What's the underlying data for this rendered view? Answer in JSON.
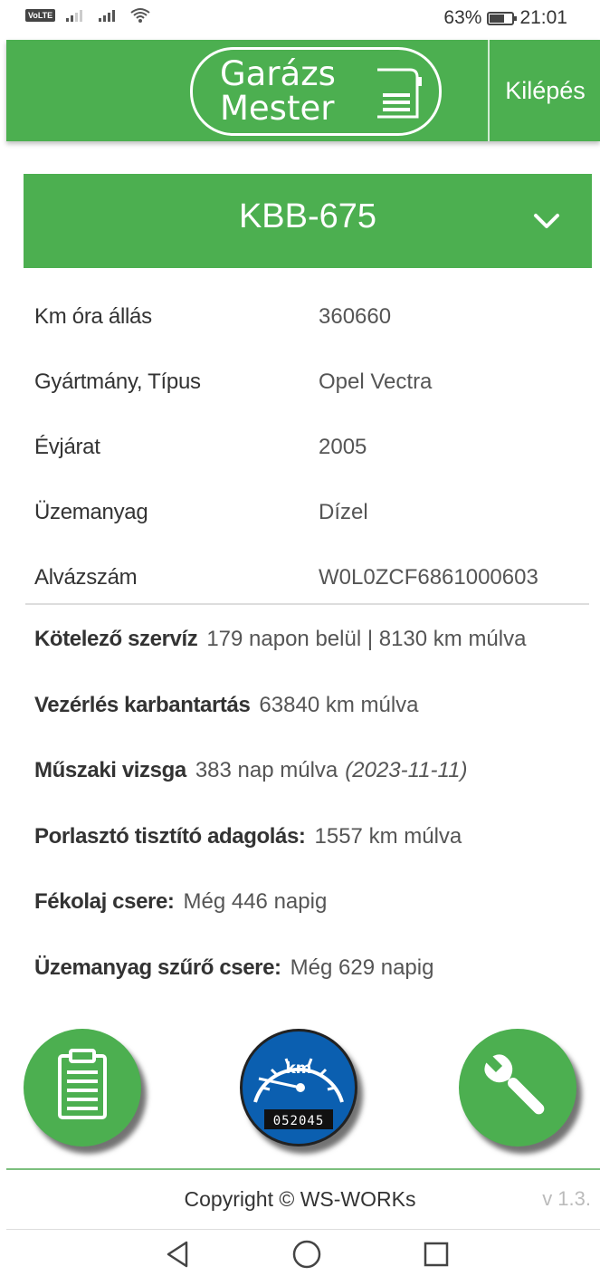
{
  "status_bar": {
    "network_badge": "VoLTE",
    "battery_percent": "63%",
    "battery_level": 0.63,
    "time": "21:01"
  },
  "header": {
    "logo_line1": "Garázs",
    "logo_line2": "Mester",
    "logout_label": "Kilépés",
    "accent_color": "#4caf50"
  },
  "vehicle": {
    "plate": "KBB-675",
    "details": [
      {
        "label": "Km óra állás",
        "value": "360660"
      },
      {
        "label": "Gyártmány, Típus",
        "value": "Opel Vectra"
      },
      {
        "label": "Évjárat",
        "value": "2005"
      },
      {
        "label": "Üzemanyag",
        "value": "Dízel"
      },
      {
        "label": "Alvázszám",
        "value": "W0L0ZCF6861000603"
      }
    ]
  },
  "services": [
    {
      "label": "Kötelező szervíz",
      "value": "179 napon belül | 8130 km múlva"
    },
    {
      "label": "Vezérlés karbantartás",
      "value": "63840 km múlva"
    },
    {
      "label": "Műszaki vizsga",
      "value": "383 nap múlva",
      "date": "(2023-11-11)"
    },
    {
      "label": "Porlasztó tisztító adagolás:",
      "value": "1557 km múlva"
    },
    {
      "label": "Fékolaj csere:",
      "value": "Még 446 napig"
    },
    {
      "label": "Üzemanyag szűrő csere:",
      "value": "Még 629 napig"
    }
  ],
  "actions": {
    "clipboard_icon": "clipboard-icon",
    "odometer_unit": "km",
    "odometer_digits": "052045",
    "wrench_icon": "wrench-icon"
  },
  "footer": {
    "copyright": "Copyright © WS-WORKs",
    "version": "v 1.3."
  },
  "nav": {
    "back_icon": "back-triangle-icon",
    "home_icon": "home-circle-icon",
    "recents_icon": "recents-square-icon"
  }
}
